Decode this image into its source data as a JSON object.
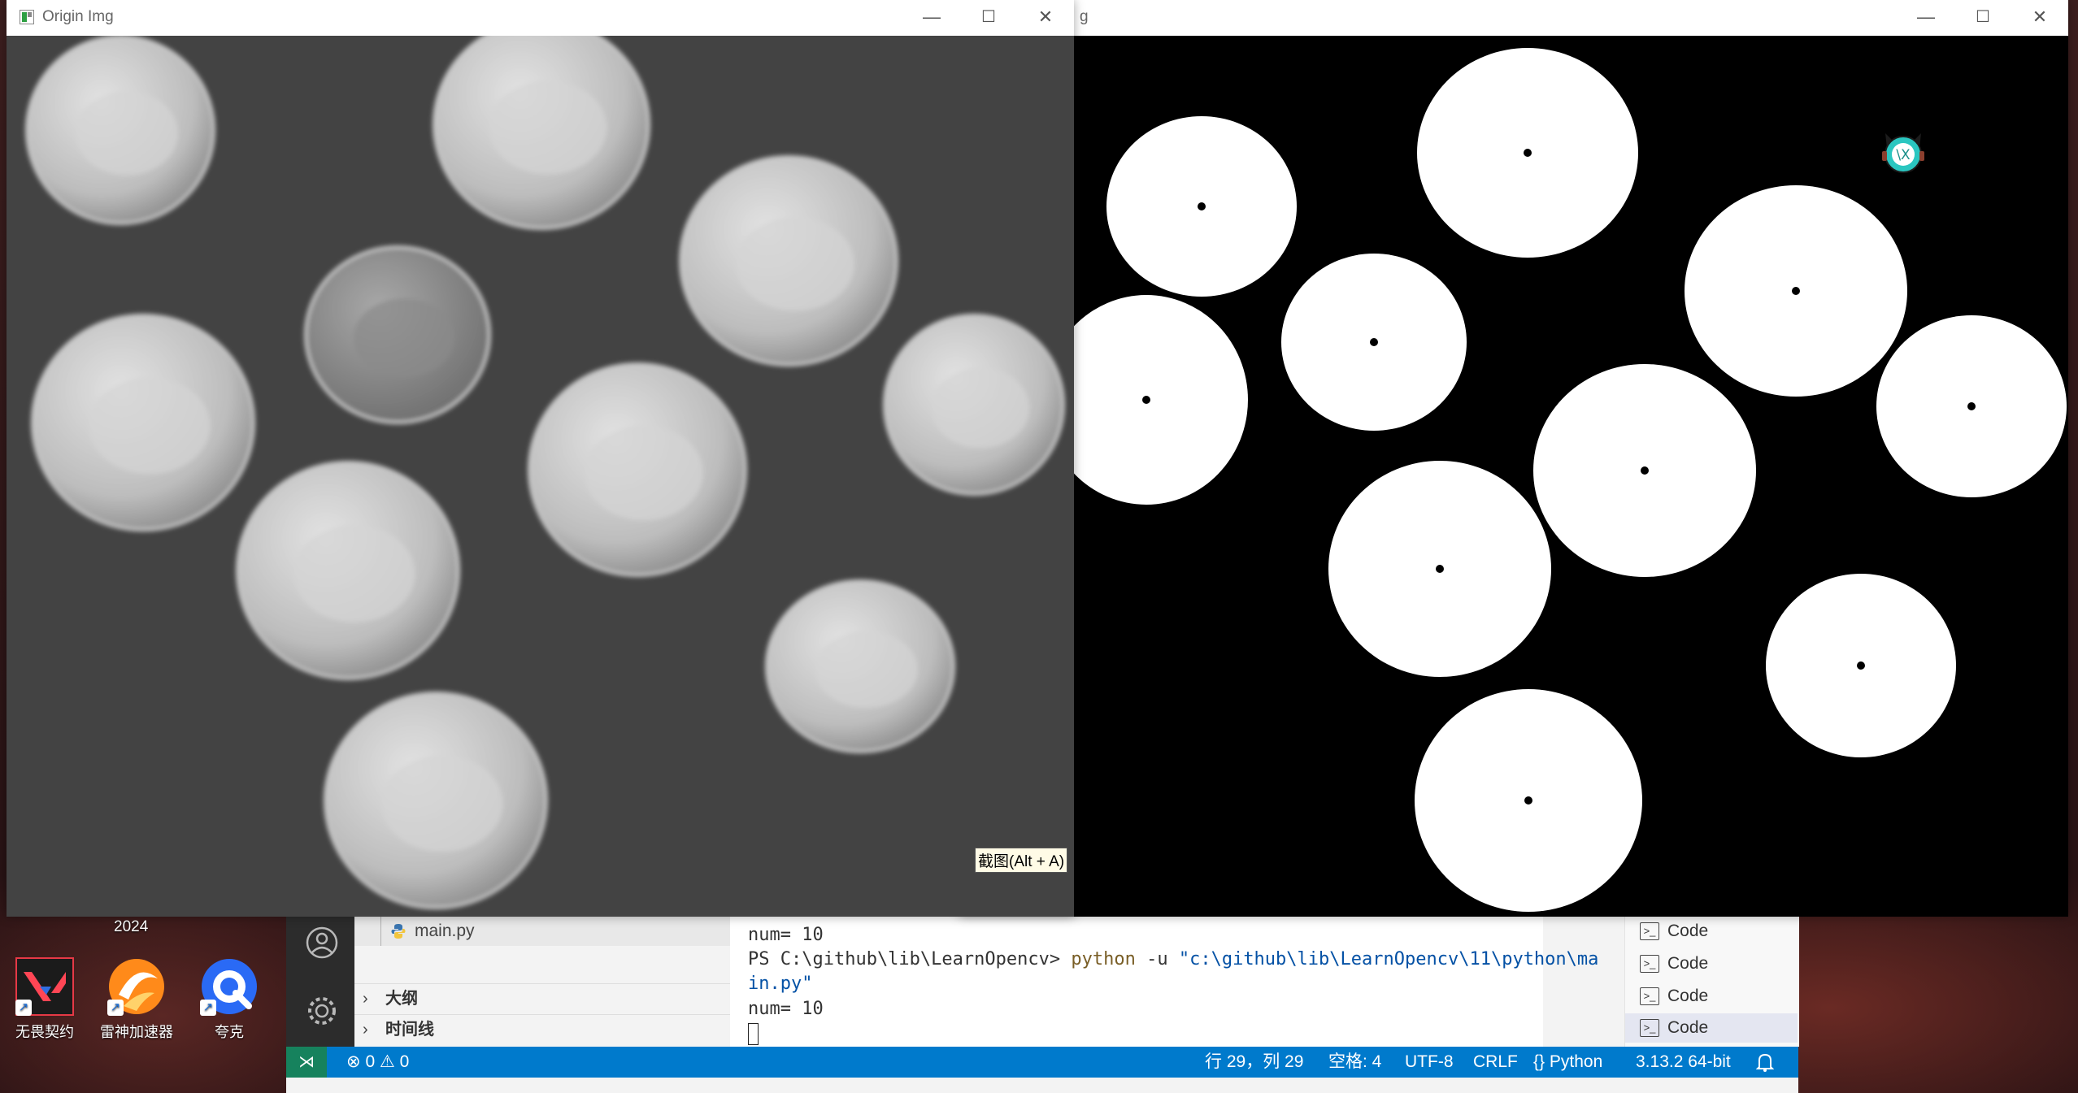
{
  "desktop": {
    "year_label": "2024",
    "icons": [
      {
        "label": "无畏契约",
        "icon": "valorant-icon"
      },
      {
        "label": "雷神加速器",
        "icon": "thunder-accelerator-icon"
      },
      {
        "label": "夸克",
        "icon": "quark-browser-icon"
      }
    ]
  },
  "windows": {
    "origin": {
      "title": "Origin Img",
      "tooltip": "截图(Alt + A)"
    },
    "result": {
      "title_fragment": "g"
    }
  },
  "window_controls": {
    "minimize": "—",
    "maximize": "☐",
    "close": "✕"
  },
  "coins": {
    "count": 10,
    "colors": {
      "background": "#434343",
      "coin": "#c8c8c8",
      "mask": "#ffffff",
      "mask_bg": "#000000",
      "center": "#000000"
    }
  },
  "vscode": {
    "explorer": {
      "file": "main.py",
      "sections": [
        "大纲",
        "时间线"
      ]
    },
    "terminal": {
      "lines": [
        "num= 10",
        "PS C:\\github\\lib\\LearnOpencv> ",
        "in.py\"",
        "num= 10"
      ],
      "command": "python",
      "args": "-u ",
      "path_arg": "\"c:\\github\\lib\\LearnOpencv\\11\\python\\ma"
    },
    "terminal_list": [
      "Code",
      "Code",
      "Code",
      "Code"
    ],
    "status": {
      "errors": "0",
      "warnings": "0",
      "position": "行 29，列 29",
      "spaces": "空格: 4",
      "encoding": "UTF-8",
      "eol": "CRLF",
      "language": "Python",
      "interpreter": "3.13.2 64-bit"
    }
  }
}
